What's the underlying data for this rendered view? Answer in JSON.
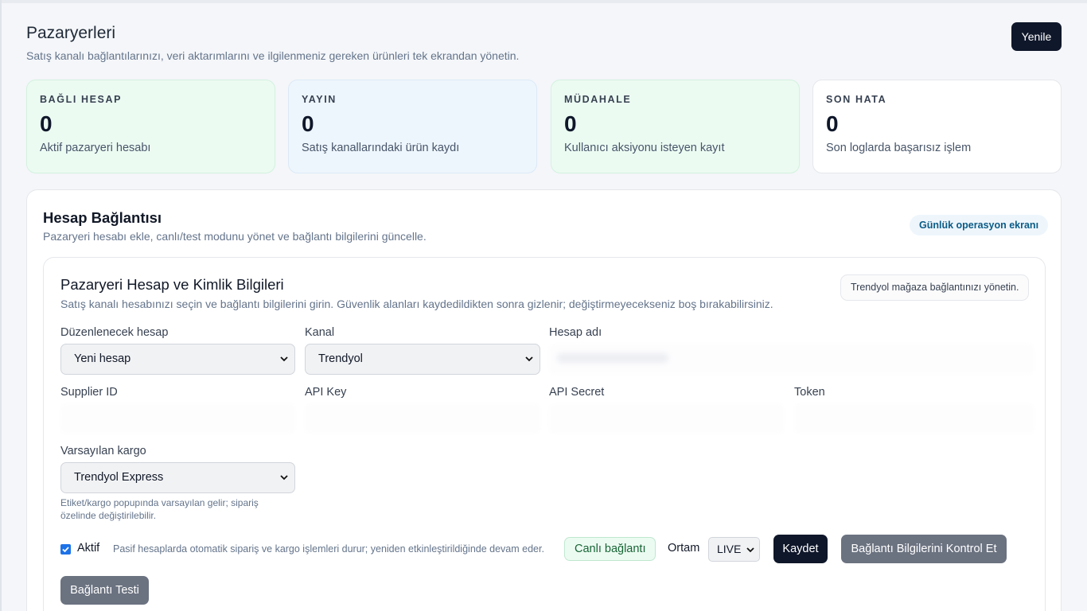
{
  "header": {
    "title": "Pazaryerleri",
    "subtitle": "Satış kanalı bağlantılarınızı, veri aktarımlarını ve ilgilenmeniz gereken ürünleri tek ekrandan yönetin.",
    "refresh_label": "Yenile"
  },
  "stats": [
    {
      "label": "BAĞLI HESAP",
      "value": "0",
      "desc": "Aktif pazaryeri hesabı",
      "color": "#ecfbf2"
    },
    {
      "label": "YAYIN",
      "value": "0",
      "desc": "Satış kanallarındaki ürün kaydı",
      "color": "#eef6fd"
    },
    {
      "label": "MÜDAHALE",
      "value": "0",
      "desc": "Kullanıcı aksiyonu isteyen kayıt",
      "color": "#ecfbf2"
    },
    {
      "label": "SON HATA",
      "value": "0",
      "desc": "Son loglarda başarısız işlem",
      "color": "#ffffff"
    }
  ],
  "panel": {
    "title": "Hesap Bağlantısı",
    "subtitle": "Pazaryeri hesabı ekle, canlı/test modunu yönet ve bağlantı bilgilerini güncelle.",
    "badge": "Günlük operasyon ekranı"
  },
  "form": {
    "title": "Pazaryeri Hesap ve Kimlik Bilgileri",
    "subtitle": "Satış kanalı hesabınızı seçin ve bağlantı bilgilerini girin. Güvenlik alanları kaydedildikten sonra gizlenir; değiştirmeyecekseniz boş bırakabilirsiniz.",
    "manage_note": "Trendyol mağaza bağlantınızı yönetin.",
    "account_label": "Düzenlenecek hesap",
    "account_value": "Yeni hesap",
    "channel_label": "Kanal",
    "channel_value": "Trendyol",
    "account_name_label": "Hesap adı",
    "supplier_label": "Supplier ID",
    "api_key_label": "API Key",
    "api_secret_label": "API Secret",
    "token_label": "Token",
    "cargo_label": "Varsayılan kargo",
    "cargo_value": "Trendyol Express",
    "cargo_hint": "Etiket/kargo popupında varsayılan gelir; sipariş özelinde değiştirilebilir.",
    "active_label": "Aktif",
    "active_checked": true,
    "active_note": "Pasif hesaplarda otomatik sipariş ve kargo işlemleri durur; yeniden etkinleştirildiğinde devam eder.",
    "live_badge": "Canlı bağlantı",
    "env_label": "Ortam",
    "env_value": "LIVE",
    "save_label": "Kaydet",
    "check_label": "Bağlantı Bilgilerini Kontrol Et",
    "test_label": "Bağlantı Testi"
  }
}
